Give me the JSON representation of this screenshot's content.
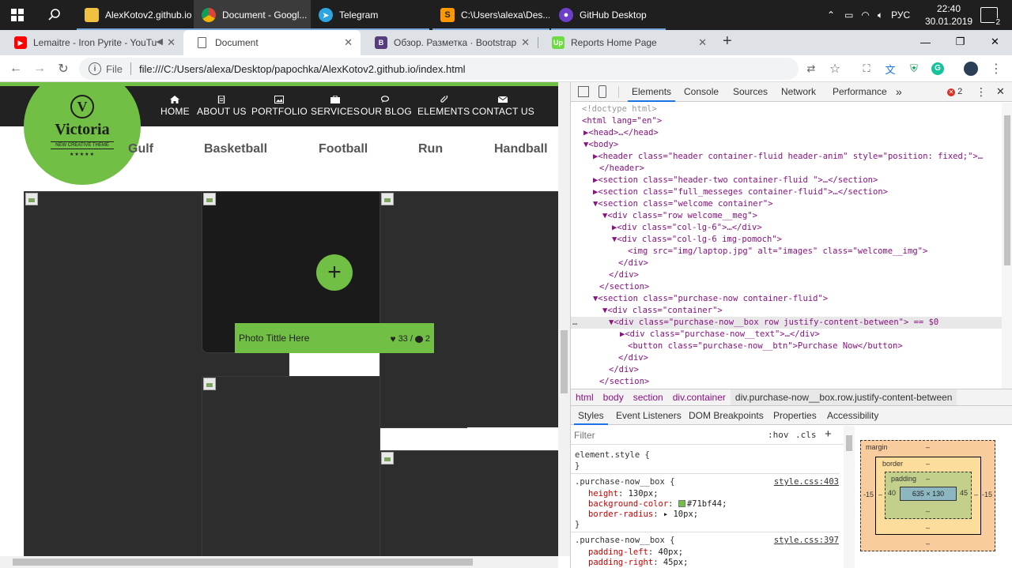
{
  "taskbar": {
    "items": [
      {
        "label": "AlexKotov2.github.io",
        "icon": "folder-icon"
      },
      {
        "label": "Document - Googl...",
        "icon": "chrome-icon"
      },
      {
        "label": "Telegram",
        "icon": "telegram-icon"
      },
      {
        "label": "C:\\Users\\alexa\\Des...",
        "icon": "sublime-icon"
      },
      {
        "label": "GitHub Desktop",
        "icon": "github-desktop-icon"
      }
    ],
    "tray": {
      "language": "РУС",
      "time": "22:40",
      "date": "30.01.2019",
      "notifications": "2"
    }
  },
  "browser": {
    "tabs": [
      {
        "label": "Lemaitre - Iron Pyrite - YouTu",
        "favicon": "youtube-icon"
      },
      {
        "label": "Document",
        "favicon": "document-icon"
      },
      {
        "label": "Обзор. Разметка · Bootstrap",
        "favicon": "bootstrap-icon"
      },
      {
        "label": "Reports Home Page",
        "favicon": "upwork-icon"
      }
    ],
    "new_tab": "+",
    "address": {
      "scheme_label": "File",
      "url": "file:///C:/Users/alexa/Desktop/papochka/AlexKotov2.github.io/index.html"
    }
  },
  "site": {
    "logo": {
      "letter": "V",
      "name": "Victoria",
      "tagline": "NEW CREATIVE THEME",
      "stars": "★★★★★"
    },
    "menu": [
      "HOME",
      "ABOUT US",
      "PORTFOLIO",
      "SERVICES",
      "OUR BLOG",
      "ELEMENTS",
      "CONTACT US"
    ],
    "filters": [
      "Gulf",
      "Basketball",
      "Football",
      "Run",
      "Handball"
    ],
    "card": {
      "plus": "+",
      "caption": "Photo Tittle Here",
      "likes": "33",
      "separator": "/",
      "comments": "2"
    },
    "accent_color": "#71bf44"
  },
  "devtools": {
    "tabs": [
      "Elements",
      "Console",
      "Sources",
      "Network",
      "Performance",
      "»"
    ],
    "error_count": "2",
    "dom_lines": [
      {
        "t": "<!doctype html>"
      },
      {
        "t": "<html lang=\"en\">"
      },
      {
        "t": "▶<head>…</head>"
      },
      {
        "t": "▼<body>"
      },
      {
        "t": "▶<header class=\"header container-fluid header-anim\" style=\"position: fixed;\">…"
      },
      {
        "t": "</header>"
      },
      {
        "t": "▶<section class=\"header-two container-fluid \">…</section>"
      },
      {
        "t": "▶<section class=\"full_messeges container-fluid\">…</section>"
      },
      {
        "t": "▼<section class=\"welcome container\">"
      },
      {
        "t": "▼<div class=\"row welcome__meg\">"
      },
      {
        "t": "▶<div class=\"col-lg-6\">…</div>"
      },
      {
        "t": "▼<div class=\"col-lg-6 img-pomoch\">"
      },
      {
        "t": "<img src=\"img/laptop.jpg\" alt=\"images\" class=\"welcome__img\">"
      },
      {
        "t": "</div>"
      },
      {
        "t": "</div>"
      },
      {
        "t": "</section>"
      },
      {
        "t": "▼<section class=\"purchase-now container-fluid\">"
      },
      {
        "t": "▼<div class=\"container\">"
      },
      {
        "t": "▼<div class=\"purchase-now__box row justify-content-between\"> == $0"
      },
      {
        "t": "▶<div class=\"purchase-now__text\">…</div>"
      },
      {
        "t": "<button class=\"purchase-now__btn\">Purchase Now</button>"
      },
      {
        "t": "</div>"
      },
      {
        "t": "</div>"
      },
      {
        "t": "</section>"
      }
    ],
    "breadcrumbs": [
      "html",
      "body",
      "section",
      "div.container",
      "div.purchase-now__box.row.justify-content-between"
    ],
    "sub_tabs": [
      "Styles",
      "Event Listeners",
      "DOM Breakpoints",
      "Properties",
      "Accessibility"
    ],
    "styles_filter": {
      "placeholder": "Filter",
      "hov": ":hov",
      "cls": ".cls",
      "add": "+"
    },
    "styles": {
      "element_style": "element.style {",
      "rule1": {
        "selector": ".purchase-now__box {",
        "source": "style.css:403",
        "props": [
          {
            "name": "height",
            "value": "130px;"
          },
          {
            "name": "background-color",
            "value": "#71bf44;"
          },
          {
            "name": "border-radius",
            "value": "▸ 10px;"
          }
        ]
      },
      "rule2": {
        "selector": ".purchase-now__box {",
        "source": "style.css:397",
        "props": [
          {
            "name": "padding-left",
            "value": "40px;"
          },
          {
            "name": "padding-right",
            "value": "45px;"
          }
        ]
      },
      "close": "}"
    },
    "box_model": {
      "margin_label": "margin",
      "border_label": "border",
      "padding_label": "padding",
      "content": "635 × 130",
      "dash": "–",
      "margin_left": "-15",
      "margin_right": "-15",
      "padding_left": "40",
      "padding_right": "45"
    }
  }
}
